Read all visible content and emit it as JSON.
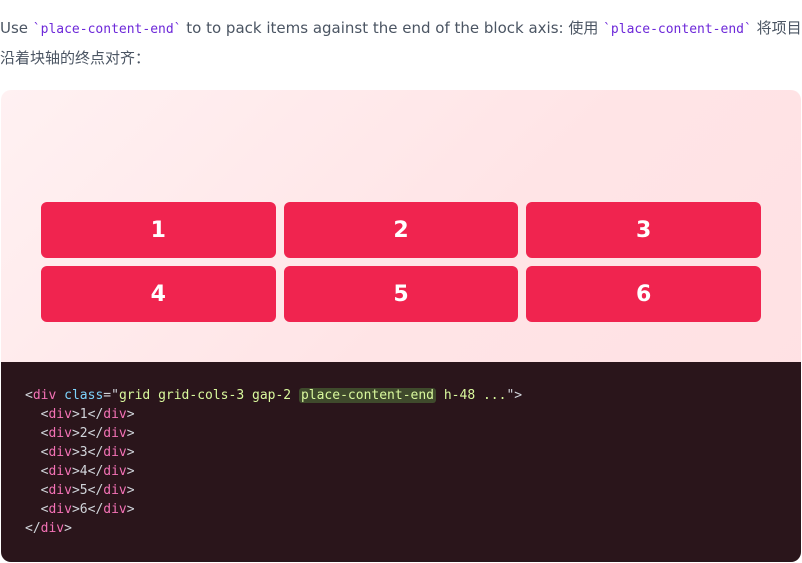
{
  "intro": {
    "before": "Use ",
    "code1": "`place-content-end`",
    "middle": " to to pack items against the end of the block axis: 使用 ",
    "code2": "`place-content-end`",
    "after": " 将项目沿着块轴的终点对齐："
  },
  "grid": {
    "items": [
      "1",
      "2",
      "3",
      "4",
      "5",
      "6"
    ],
    "accent": "#f0244f",
    "background": "#ffe4e6"
  },
  "code": {
    "open_tag": "div",
    "attr_name": "class",
    "class_before": "grid grid-cols-3 gap-2 ",
    "class_highlight": "place-content-end",
    "class_after": " h-48 ...",
    "child_tag": "div",
    "children": [
      "1",
      "2",
      "3",
      "4",
      "5",
      "6"
    ],
    "close_tag": "div",
    "background": "#2a151b"
  }
}
